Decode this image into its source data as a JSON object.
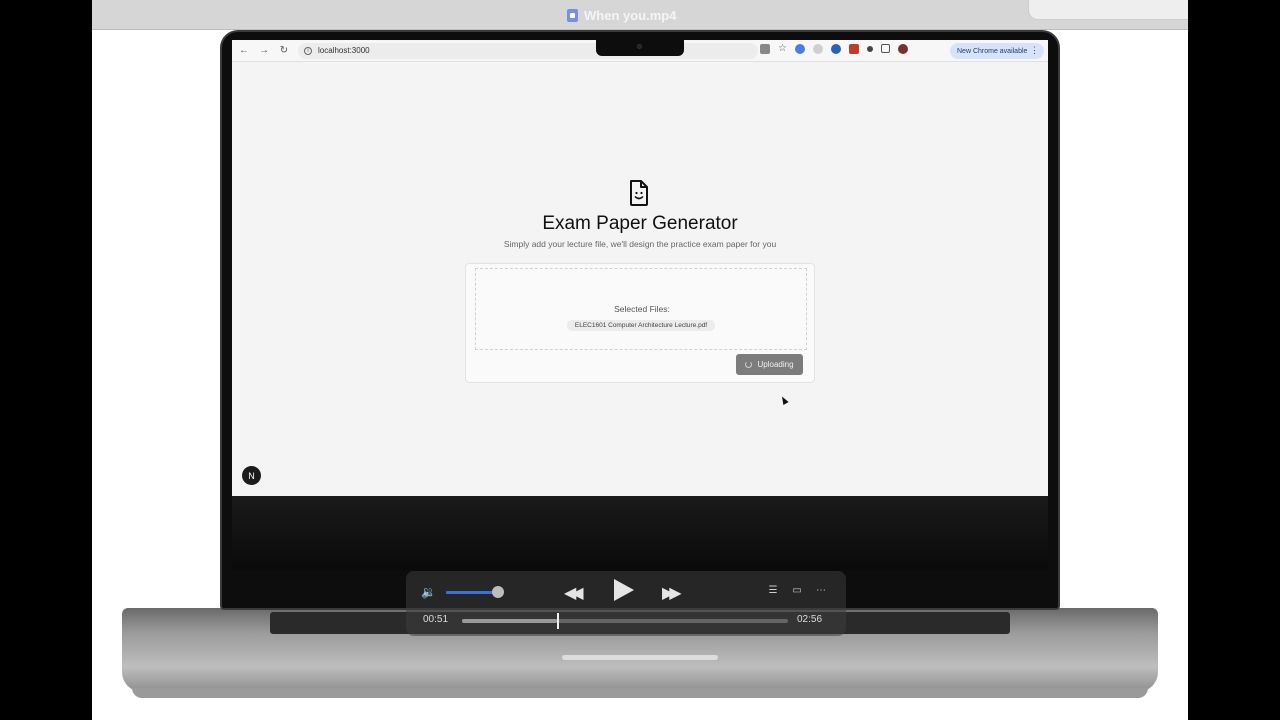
{
  "window": {
    "title": "When you.mp4"
  },
  "browser": {
    "url": "localhost:3000",
    "update_label": "New Chrome available",
    "more_label": "⋮"
  },
  "page": {
    "title": "Exam Paper Generator",
    "subtitle": "Simply add your lecture file, we'll design the practice exam paper for you",
    "selected_files_label": "Selected Files:",
    "files": [
      "ELEC1601 Computer Architecture Lecture.pdf"
    ],
    "upload_button_label": "Uploading",
    "framework_badge": "N"
  },
  "player": {
    "current_time": "00:51",
    "total_time": "02:56",
    "progress_fraction": 0.29,
    "volume_fraction": 0.9
  }
}
